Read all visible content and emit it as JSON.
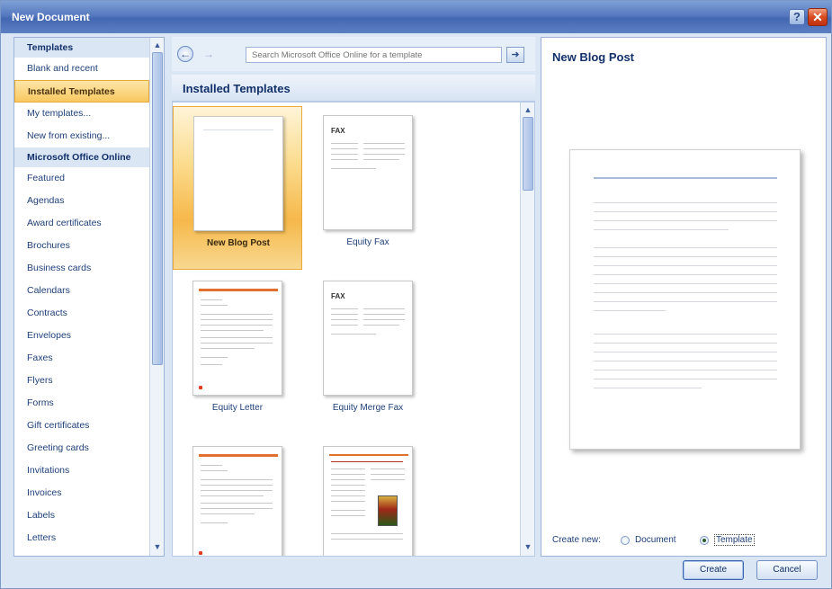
{
  "window": {
    "title": "New Document",
    "help_label": "?",
    "close_label": "✕"
  },
  "left_panel": {
    "items": [
      {
        "label": "Templates",
        "type": "header"
      },
      {
        "label": "Blank and recent",
        "type": "item"
      },
      {
        "label": "Installed Templates",
        "type": "selected"
      },
      {
        "label": "My templates...",
        "type": "item"
      },
      {
        "label": "New from existing...",
        "type": "item"
      },
      {
        "label": "Microsoft Office Online",
        "type": "header"
      },
      {
        "label": "Featured",
        "type": "item"
      },
      {
        "label": "Agendas",
        "type": "item"
      },
      {
        "label": "Award certificates",
        "type": "item"
      },
      {
        "label": "Brochures",
        "type": "item"
      },
      {
        "label": "Business cards",
        "type": "item"
      },
      {
        "label": "Calendars",
        "type": "item"
      },
      {
        "label": "Contracts",
        "type": "item"
      },
      {
        "label": "Envelopes",
        "type": "item"
      },
      {
        "label": "Faxes",
        "type": "item"
      },
      {
        "label": "Flyers",
        "type": "item"
      },
      {
        "label": "Forms",
        "type": "item"
      },
      {
        "label": "Gift certificates",
        "type": "item"
      },
      {
        "label": "Greeting cards",
        "type": "item"
      },
      {
        "label": "Invitations",
        "type": "item"
      },
      {
        "label": "Invoices",
        "type": "item"
      },
      {
        "label": "Labels",
        "type": "item"
      },
      {
        "label": "Letters",
        "type": "item"
      }
    ]
  },
  "toolbar": {
    "back_icon": "←",
    "forward_icon": "→",
    "search_placeholder": "Search Microsoft Office Online for a template",
    "search_go_icon": "➜"
  },
  "center": {
    "heading": "Installed Templates",
    "templates": [
      {
        "label": "New Blog Post",
        "selected": true
      },
      {
        "label": "Equity Fax",
        "selected": false
      },
      {
        "label": "Equity Letter",
        "selected": false
      },
      {
        "label": "Equity Merge Fax",
        "selected": false
      },
      {
        "label": "",
        "selected": false
      },
      {
        "label": "",
        "selected": false
      }
    ],
    "fax_text": "FAX"
  },
  "preview": {
    "title": "New Blog Post",
    "create_new_label": "Create new:",
    "option_document": "Document",
    "option_template": "Template",
    "selected_option": "Template"
  },
  "buttons": {
    "create": "Create",
    "cancel": "Cancel"
  },
  "colors": {
    "accent_orange": "#e07030",
    "selection": "#f8c860",
    "title_blue": "#12306a"
  }
}
